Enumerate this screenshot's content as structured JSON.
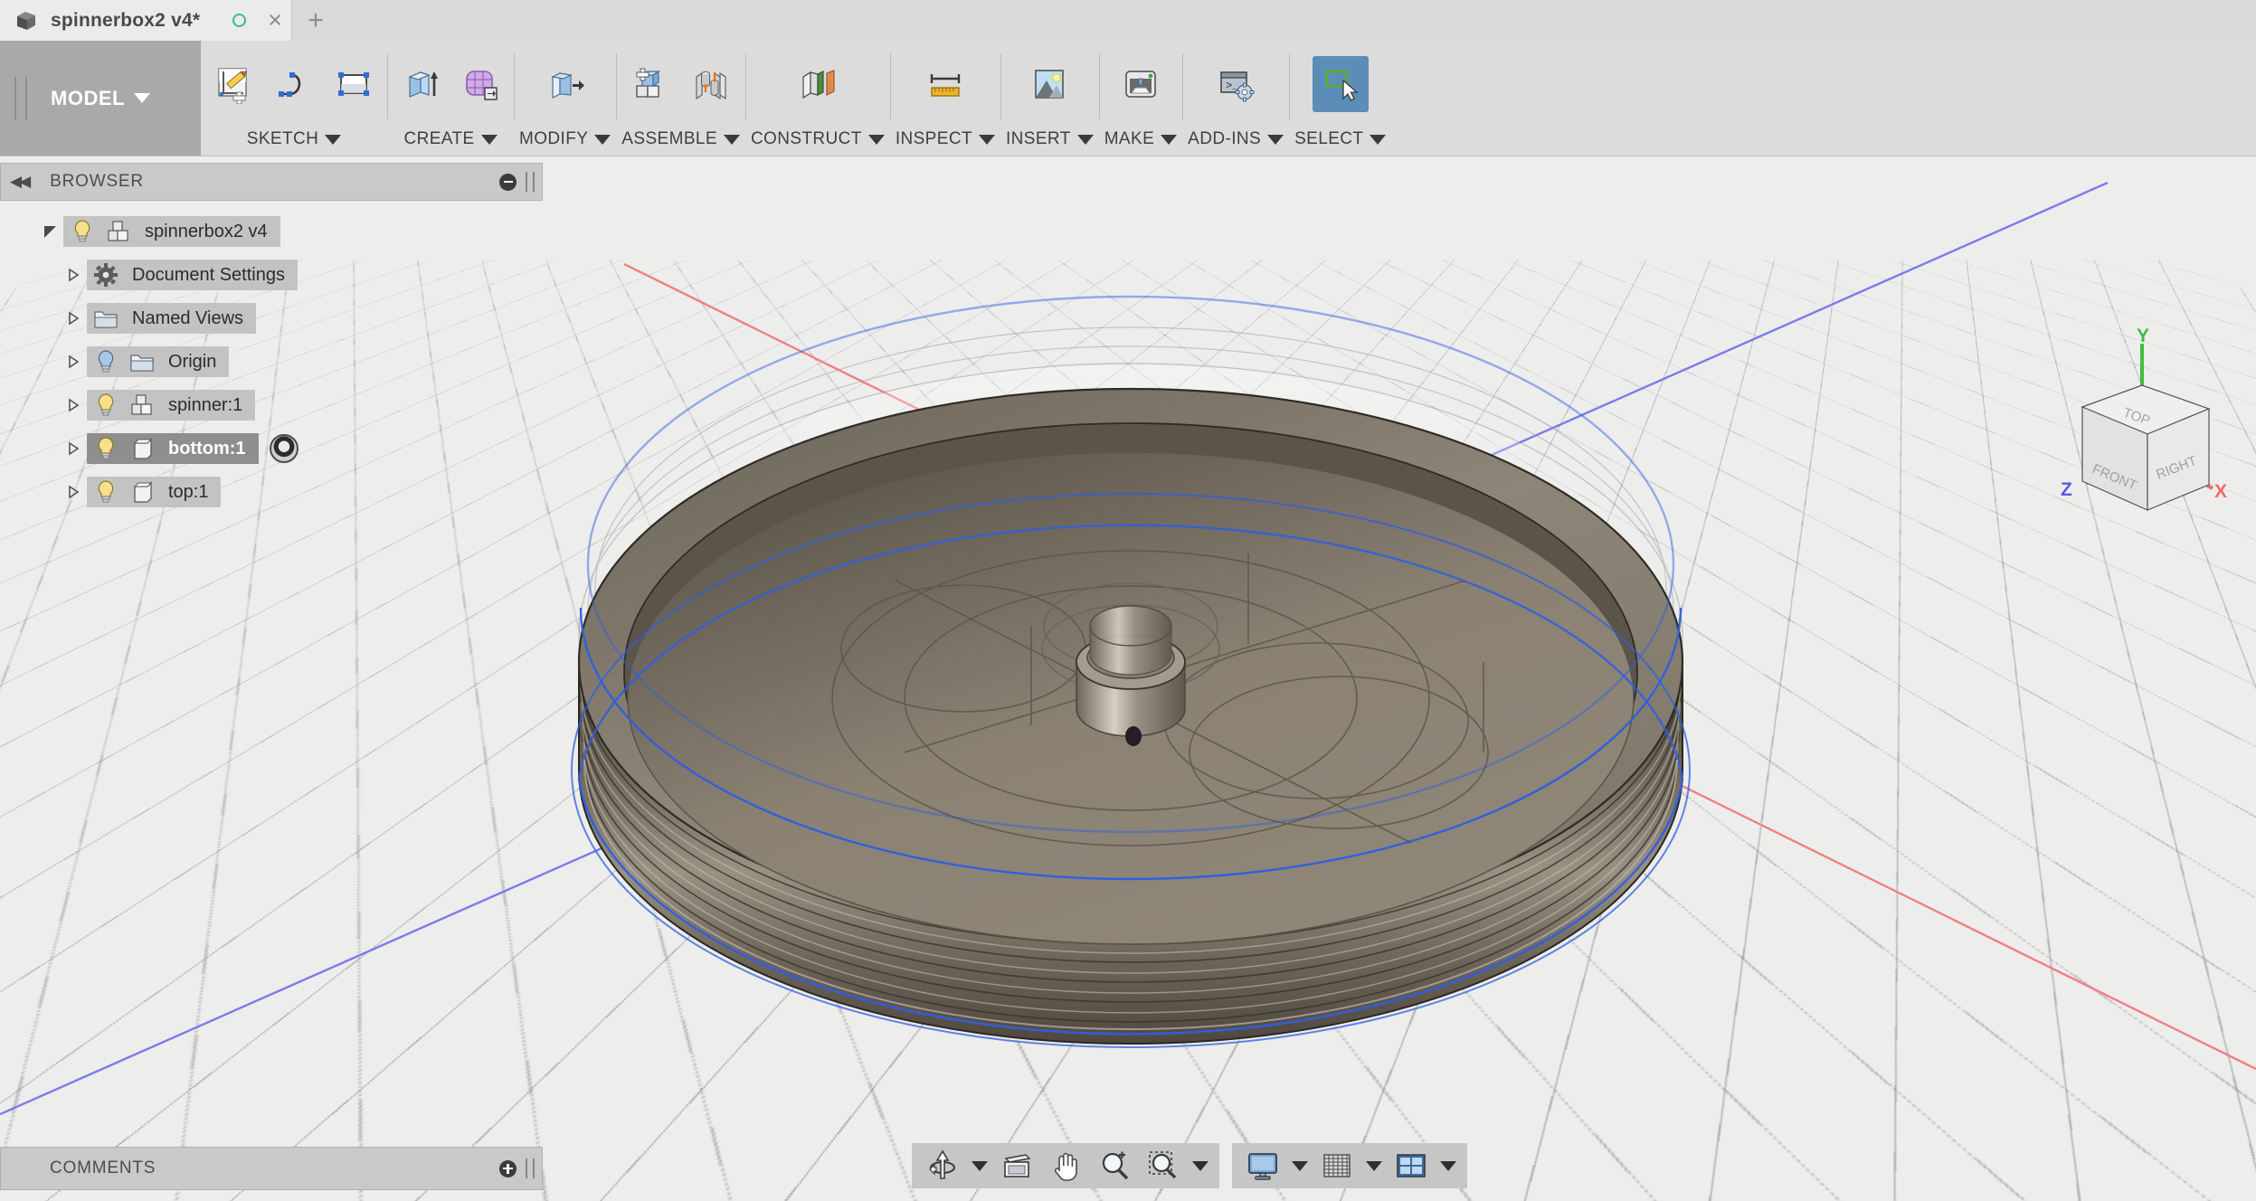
{
  "window": {
    "tab_title": "spinnerbox2 v4*",
    "doc_icon": "cube-icon",
    "save_state_icon": "unsaved-circle-icon",
    "close_label": "×",
    "new_tab_label": "+"
  },
  "ribbon": {
    "workspace": {
      "label": "MODEL",
      "caret": "▼"
    },
    "groups": [
      {
        "name": "sketch",
        "label": "SKETCH",
        "caret": "▼",
        "icons": [
          "create-sketch-icon",
          "spline-icon",
          "rectangle-icon"
        ]
      },
      {
        "name": "create",
        "label": "CREATE",
        "caret": "▼",
        "icons": [
          "extrude-icon",
          "create-form-icon"
        ]
      },
      {
        "name": "modify",
        "label": "MODIFY",
        "caret": "▼",
        "icons": [
          "press-pull-icon"
        ]
      },
      {
        "name": "assemble",
        "label": "ASSEMBLE",
        "caret": "▼",
        "icons": [
          "new-component-icon",
          "joint-icon"
        ]
      },
      {
        "name": "construct",
        "label": "CONSTRUCT",
        "caret": "▼",
        "icons": [
          "offset-plane-icon"
        ]
      },
      {
        "name": "inspect",
        "label": "INSPECT",
        "caret": "▼",
        "icons": [
          "measure-icon"
        ]
      },
      {
        "name": "insert",
        "label": "INSERT",
        "caret": "▼",
        "icons": [
          "insert-image-icon"
        ]
      },
      {
        "name": "make",
        "label": "MAKE",
        "caret": "▼",
        "icons": [
          "3d-print-icon"
        ]
      },
      {
        "name": "addins",
        "label": "ADD-INS",
        "caret": "▼",
        "icons": [
          "script-addin-icon"
        ]
      },
      {
        "name": "select",
        "label": "SELECT",
        "caret": "▼",
        "icons": [
          "select-window-icon"
        ],
        "selected": true
      }
    ]
  },
  "browser": {
    "title": "BROWSER",
    "collapse_icon": "collapse-left-icon",
    "minimize_icon": "minimize-icon",
    "tree": [
      {
        "label": "spinnerbox2 v4",
        "indent": 0,
        "twist": "down",
        "bulb": "yellow",
        "icon": "component-icon",
        "selected": false,
        "pill": true
      },
      {
        "label": "Document Settings",
        "indent": 1,
        "twist": "right",
        "bulb": "none",
        "icon": "gear-icon",
        "selected": false,
        "pill": true
      },
      {
        "label": "Named Views",
        "indent": 1,
        "twist": "right",
        "bulb": "none",
        "icon": "folder-icon",
        "selected": false,
        "pill": true
      },
      {
        "label": "Origin",
        "indent": 1,
        "twist": "right",
        "bulb": "blue",
        "icon": "folder-icon",
        "selected": false,
        "pill": true
      },
      {
        "label": "spinner:1",
        "indent": 1,
        "twist": "right",
        "bulb": "yellow",
        "icon": "component-icon",
        "selected": false,
        "pill": true
      },
      {
        "label": "bottom:1",
        "indent": 1,
        "twist": "right",
        "bulb": "yellow",
        "icon": "body-icon",
        "selected": true,
        "pill": true,
        "badge": "contextual-target-icon"
      },
      {
        "label": "top:1",
        "indent": 1,
        "twist": "right",
        "bulb": "yellow",
        "icon": "body-icon",
        "selected": false,
        "pill": true
      }
    ]
  },
  "comments": {
    "title": "COMMENTS",
    "add_icon": "add-comment-icon"
  },
  "navbar": {
    "group_a": [
      {
        "name": "orbit-icon",
        "caret": true
      },
      {
        "name": "look-at-icon",
        "caret": false
      },
      {
        "name": "pan-hand-icon",
        "caret": false
      },
      {
        "name": "zoom-in-icon",
        "caret": false
      },
      {
        "name": "zoom-window-icon",
        "caret": true
      }
    ],
    "group_b": [
      {
        "name": "display-settings-icon",
        "caret": true
      },
      {
        "name": "grid-snaps-icon",
        "caret": true
      },
      {
        "name": "viewports-icon",
        "caret": true
      }
    ]
  },
  "viewcube": {
    "faces": {
      "top": "TOP",
      "front": "FRONT",
      "right": "RIGHT"
    },
    "axes": {
      "y": "Y",
      "z": "Z",
      "x": "X"
    },
    "axis_colors": {
      "y": "#3fbf3f",
      "z": "#5a5ae0",
      "x": "#ef6a6a"
    }
  },
  "colors": {
    "canvas_bg": "#ededec",
    "grid_line": "#7a7c7a",
    "axis_x": "#f08080",
    "axis_z": "#7b7bf0",
    "model_body": "#8a8174",
    "model_body_dark": "#6b6357",
    "selection_edge": "#2e5fe0",
    "ribbon_bg": "#dcdcdc",
    "panel_bg": "#c9c9c9",
    "workspace_tab": "#a9a9a9",
    "accent_select": "#5b8db8",
    "unsaved_dot": "#3cba8f"
  }
}
